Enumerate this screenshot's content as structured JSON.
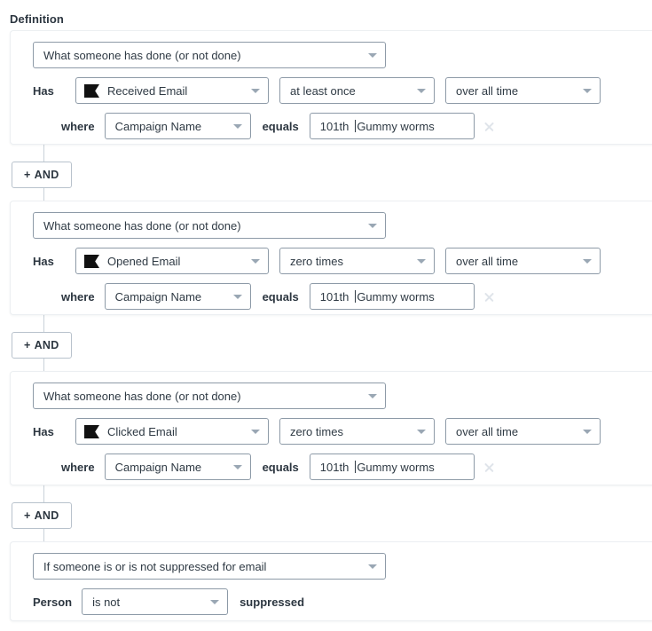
{
  "section": {
    "title": "Definition"
  },
  "icons": {
    "dropdown_caret": "chevron-down-icon",
    "remove": "close-icon",
    "metric_flag": "flag-icon"
  },
  "blocks": [
    {
      "id": "block-1",
      "trigger_select": "What someone has done (or not done)",
      "has_label": "Has",
      "metric_select": "Received Email",
      "frequency_select": "at least once",
      "timeframe_select": "over all time",
      "where_label": "where",
      "property_select": "Campaign Name",
      "operator_label": "equals",
      "value_input": "101th ",
      "value_input_tail": "Gummy worms",
      "value_full": "101th |Gummy worms"
    },
    {
      "id": "block-2",
      "trigger_select": "What someone has done (or not done)",
      "has_label": "Has",
      "metric_select": "Opened Email",
      "frequency_select": "zero times",
      "timeframe_select": "over all time",
      "where_label": "where",
      "property_select": "Campaign Name",
      "operator_label": "equals",
      "value_input": "101th ",
      "value_input_tail": "Gummy worms",
      "value_full": "101th |Gummy worms"
    },
    {
      "id": "block-3",
      "trigger_select": "What someone has done (or not done)",
      "has_label": "Has",
      "metric_select": "Clicked Email",
      "frequency_select": "zero times",
      "timeframe_select": "over all time",
      "where_label": "where",
      "property_select": "Campaign Name",
      "operator_label": "equals",
      "value_input": "101th ",
      "value_input_tail": "Gummy worms",
      "value_full": "101th |Gummy worms"
    }
  ],
  "suppression_block": {
    "id": "block-4",
    "trigger_select": "If someone is or is not suppressed for email",
    "person_label": "Person",
    "state_select": "is not",
    "suffix_label": "suppressed"
  },
  "and_buttons": [
    {
      "plus": "+",
      "label": "AND"
    },
    {
      "plus": "+",
      "label": "AND"
    },
    {
      "plus": "+",
      "label": "AND"
    }
  ],
  "colors": {
    "text_primary": "#2c3640",
    "text_secondary": "#3f4a54",
    "control_border": "#8d9aa7",
    "card_border": "#eceff2",
    "caret": "#9aa7b4",
    "remove_x": "#dfe4ea",
    "icon_black": "#111111",
    "page_bg": "#ffffff"
  }
}
